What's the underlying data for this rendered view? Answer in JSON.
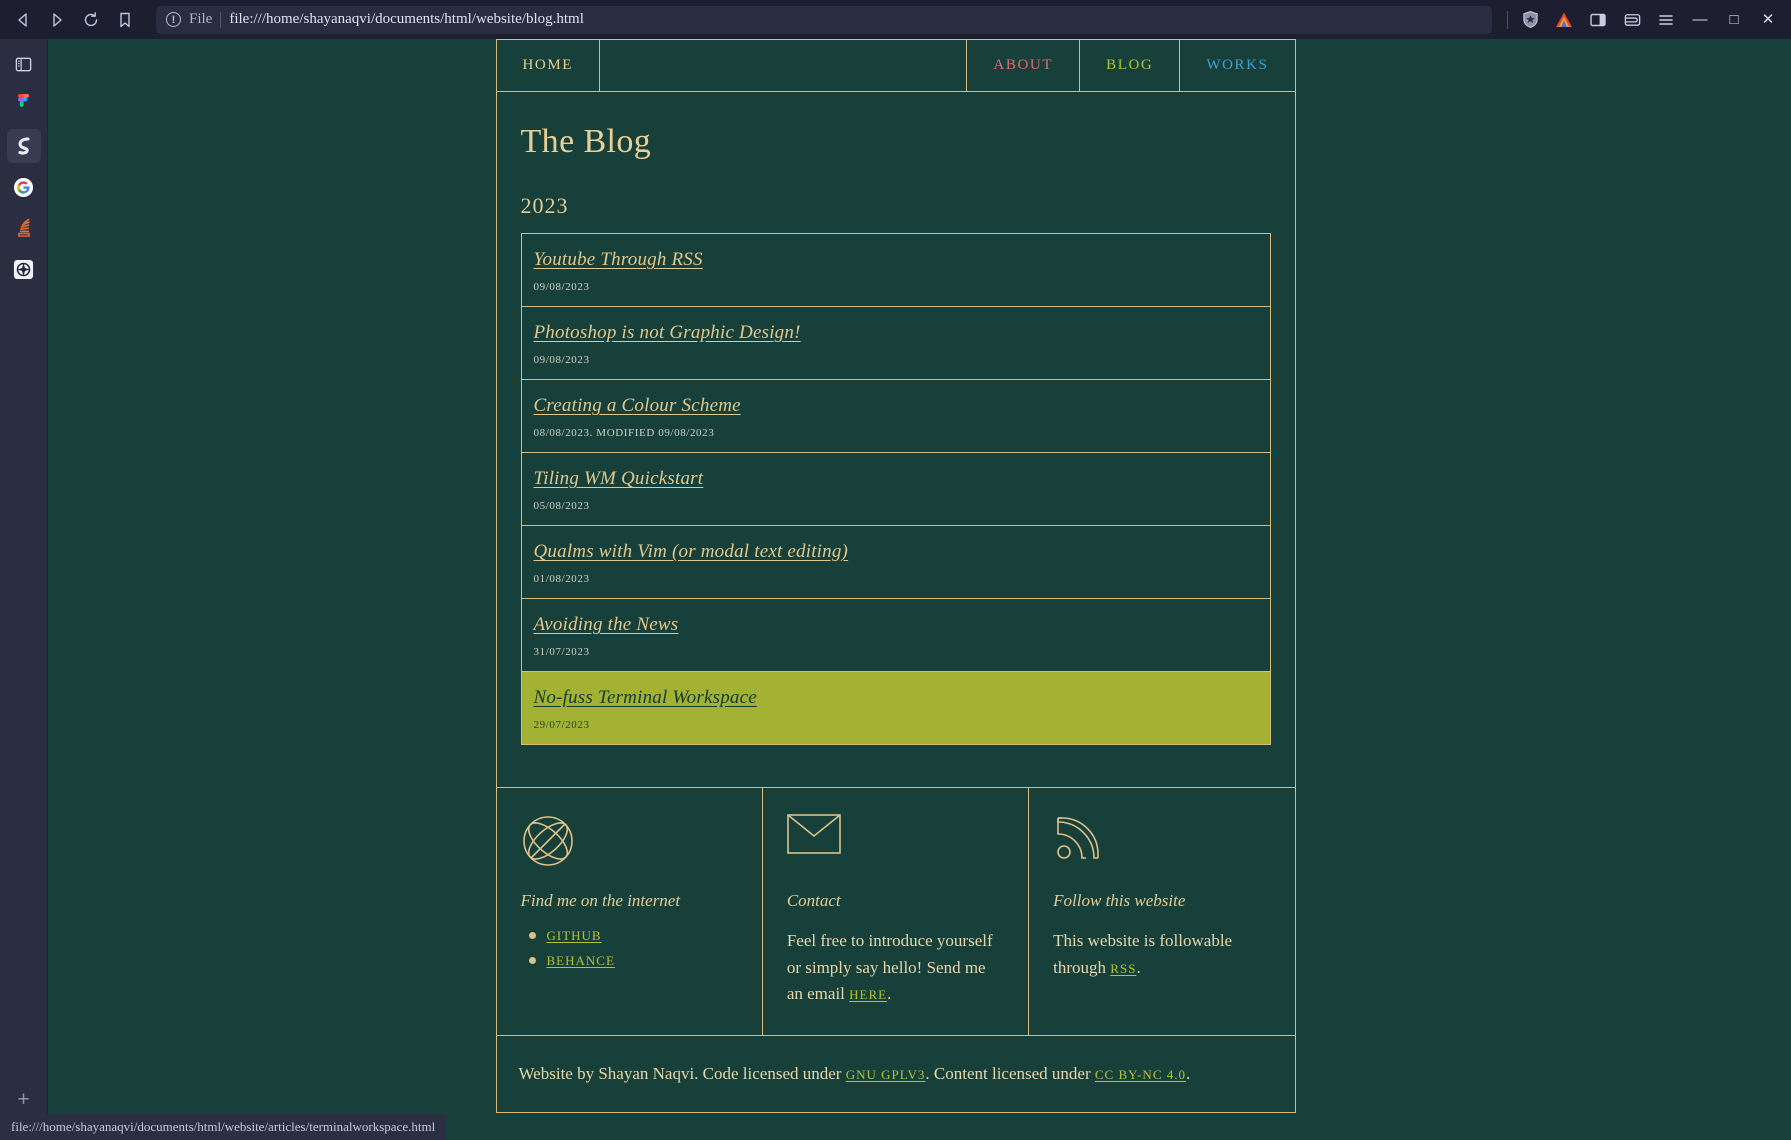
{
  "browser": {
    "back_icon": "back-arrow-icon",
    "forward_icon": "forward-arrow-icon",
    "reload_icon": "reload-icon",
    "bookmark_icon": "bookmark-icon",
    "urlbar": {
      "info_icon_glyph": "!",
      "scheme_label": "File",
      "url": "file:///home/shayanaqvi/documents/html/website/blog.html"
    },
    "toolbar_icons": [
      "brave-shields-icon",
      "leo-ai-icon",
      "sidebar-toggle-icon",
      "wallet-icon",
      "hamburger-menu-icon"
    ],
    "window_controls": {
      "minimize": "—",
      "maximize": "□",
      "close": "✕"
    },
    "status_bar_url": "file:///home/shayanaqvi/documents/html/website/articles/terminalworkspace.html"
  },
  "side_rail": {
    "items": [
      {
        "name": "sidebar-panel-icon",
        "selected": false
      },
      {
        "name": "figma-icon",
        "selected": false
      },
      {
        "name": "obsidian-s-icon",
        "selected": true
      },
      {
        "name": "google-icon",
        "selected": false
      },
      {
        "name": "stack-overflow-icon",
        "selected": false
      },
      {
        "name": "brave-rewards-icon",
        "selected": false
      }
    ],
    "add_label": "+"
  },
  "site": {
    "nav": [
      {
        "id": "home",
        "label": "HOME",
        "color": "#e8cf95"
      },
      {
        "id": "about",
        "label": "ABOUT",
        "color": "#e06b72"
      },
      {
        "id": "blog",
        "label": "BLOG",
        "color": "#b5c234"
      },
      {
        "id": "works",
        "label": "WORKS",
        "color": "#3f9fd4"
      }
    ],
    "page_title": "The Blog",
    "year_heading": "2023",
    "posts": [
      {
        "title": "Youtube Through RSS",
        "date": "09/08/2023",
        "hovered": false
      },
      {
        "title": "Photoshop is not Graphic Design!",
        "date": "09/08/2023",
        "hovered": false
      },
      {
        "title": "Creating a Colour Scheme",
        "date": "08/08/2023. MODIFIED 09/08/2023",
        "hovered": false
      },
      {
        "title": "Tiling WM Quickstart",
        "date": "05/08/2023",
        "hovered": false
      },
      {
        "title": "Qualms with Vim (or modal text editing)",
        "date": "01/08/2023",
        "hovered": false
      },
      {
        "title": "Avoiding the News",
        "date": "31/07/2023",
        "hovered": false
      },
      {
        "title": "No-fuss Terminal Workspace",
        "date": "29/07/2023",
        "hovered": true
      }
    ],
    "footer": {
      "internet": {
        "icon": "globe-network-icon",
        "heading": "Find me on the internet",
        "links": [
          "GITHUB",
          "BEHANCE"
        ]
      },
      "contact": {
        "icon": "envelope-icon",
        "heading": "Contact",
        "text_before": "Feel free to introduce yourself or simply say hello! Send me an email ",
        "link": "HERE",
        "text_after": "."
      },
      "follow": {
        "icon": "rss-icon",
        "heading": "Follow this website",
        "text_before": "This website is followable through ",
        "link": "RSS",
        "text_after": "."
      }
    },
    "colophon": {
      "part1": "Website by Shayan Naqvi. Code licensed under ",
      "link1": "GNU GPLV3",
      "part2": ". Content licensed under ",
      "link2": "CC BY-NC 4.0",
      "part3": "."
    }
  },
  "colors": {
    "page_bg": "#17403a",
    "border_gold": "#d9bd7e",
    "text_gold": "#e3c88d",
    "hover_olive": "#a4b233",
    "link_green": "#b5c234",
    "nav_red": "#e06b72",
    "nav_blue": "#3f9fd4",
    "chrome_bg": "#222436"
  }
}
